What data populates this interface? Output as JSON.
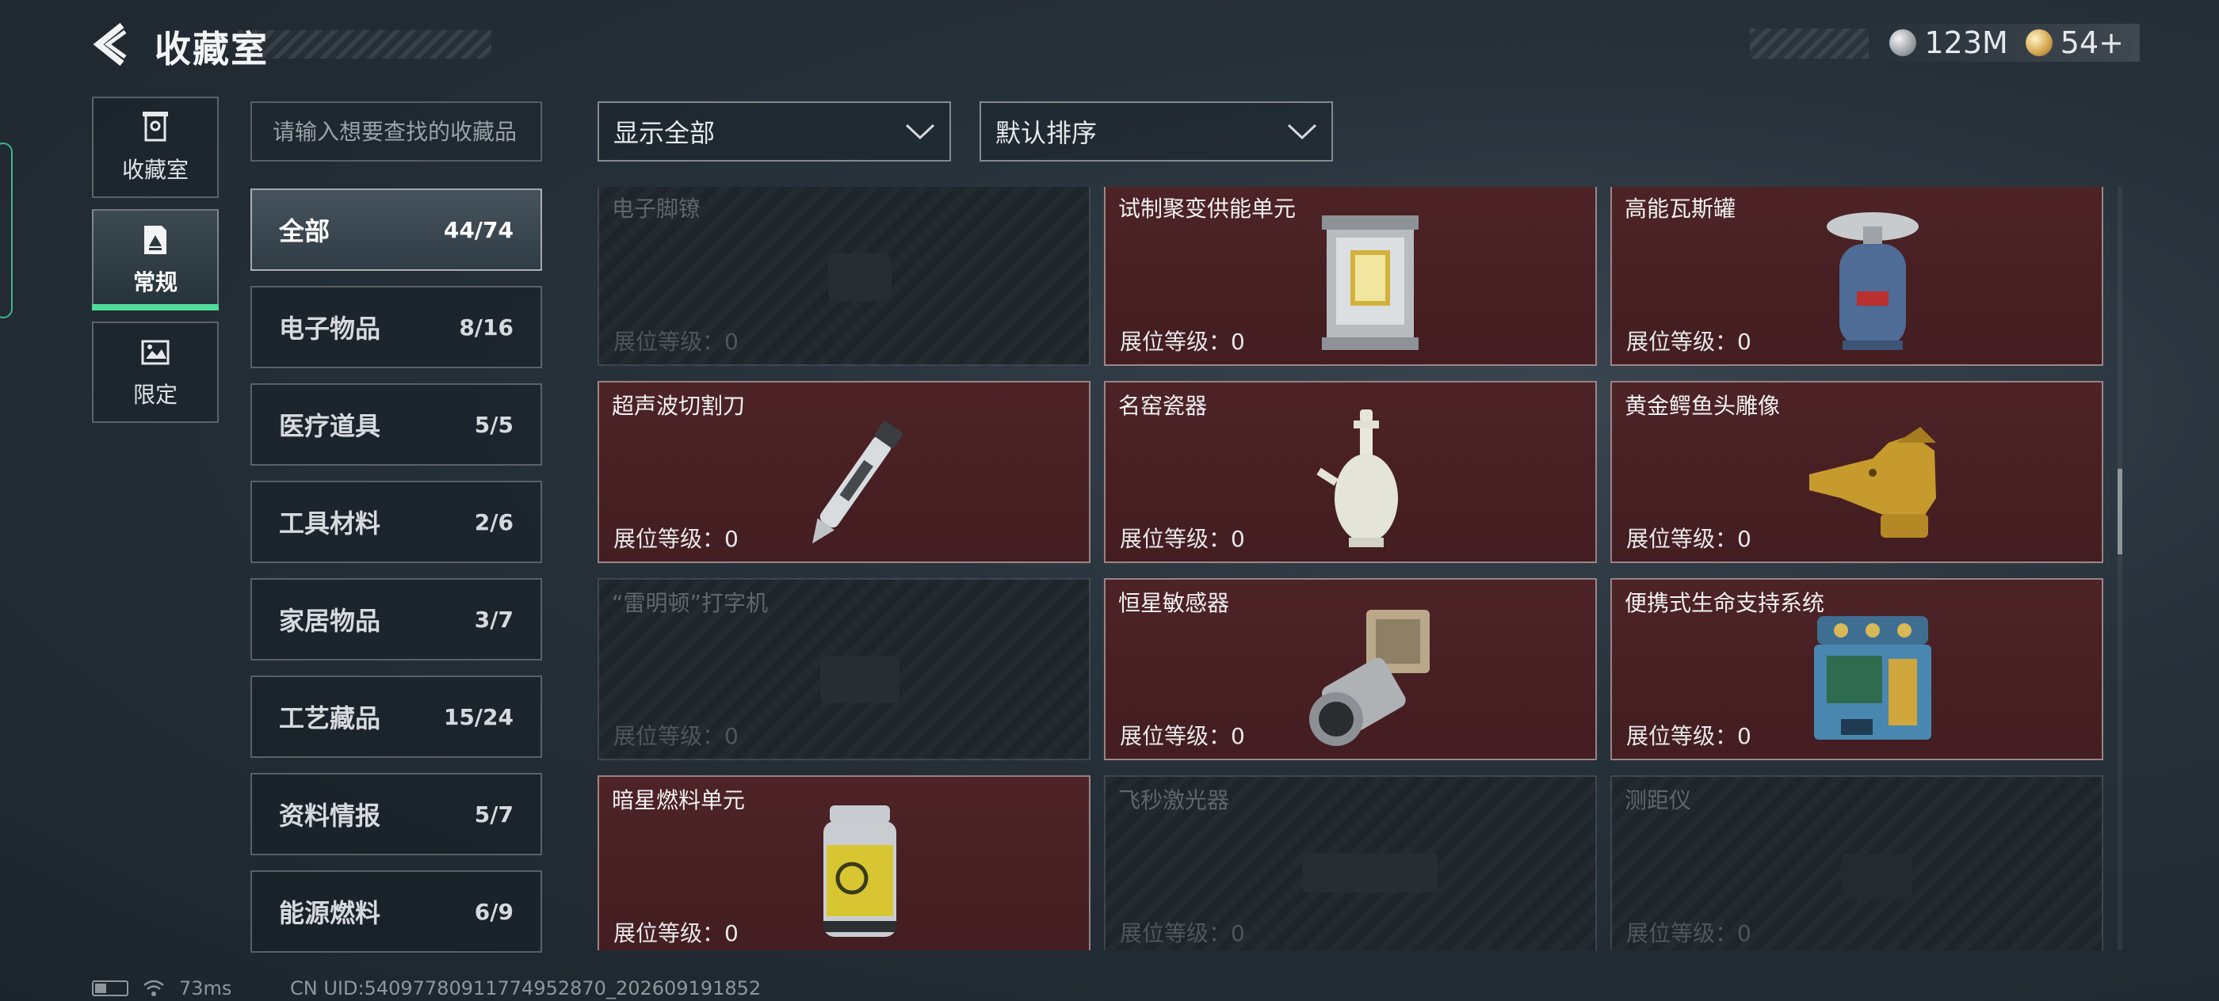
{
  "header": {
    "title": "收藏室",
    "currencies": [
      {
        "icon": "silver-coin-icon",
        "value": "123M"
      },
      {
        "icon": "gold-coin-icon",
        "value": "54+"
      }
    ]
  },
  "side_tabs": [
    {
      "label": "收藏室",
      "icon": "storage-icon",
      "active": false
    },
    {
      "label": "常规",
      "icon": "regular-collection-icon",
      "active": true
    },
    {
      "label": "限定",
      "icon": "limited-collection-icon",
      "active": false
    }
  ],
  "search": {
    "placeholder": "请输入想要查找的收藏品",
    "value": ""
  },
  "filters": {
    "display": "显示全部",
    "sort": "默认排序"
  },
  "categories": [
    {
      "name": "全部",
      "count": "44/74",
      "active": true
    },
    {
      "name": "电子物品",
      "count": "8/16"
    },
    {
      "name": "医疗道具",
      "count": "5/5"
    },
    {
      "name": "工具材料",
      "count": "2/6"
    },
    {
      "name": "家居物品",
      "count": "3/7"
    },
    {
      "name": "工艺藏品",
      "count": "15/24"
    },
    {
      "name": "资料情报",
      "count": "5/7"
    },
    {
      "name": "能源燃料",
      "count": "6/9"
    }
  ],
  "grade_label": "展位等级：",
  "items": [
    {
      "name": "电子脚镣",
      "grade": "0",
      "owned": false,
      "icon": "electronic-anklet-icon"
    },
    {
      "name": "试制聚变供能单元",
      "grade": "0",
      "owned": true,
      "icon": "fusion-power-unit-icon"
    },
    {
      "name": "高能瓦斯罐",
      "grade": "0",
      "owned": true,
      "icon": "gas-canister-icon"
    },
    {
      "name": "超声波切割刀",
      "grade": "0",
      "owned": true,
      "icon": "ultrasonic-cutter-icon"
    },
    {
      "name": "名窑瓷器",
      "grade": "0",
      "owned": true,
      "icon": "porcelain-vase-icon"
    },
    {
      "name": "黄金鳄鱼头雕像",
      "grade": "0",
      "owned": true,
      "icon": "golden-crocodile-statue-icon"
    },
    {
      "name": "“雷明顿”打字机",
      "grade": "0",
      "owned": false,
      "icon": "typewriter-icon"
    },
    {
      "name": "恒星敏感器",
      "grade": "0",
      "owned": true,
      "icon": "star-sensor-icon"
    },
    {
      "name": "便携式生命支持系统",
      "grade": "0",
      "owned": true,
      "icon": "life-support-system-icon"
    },
    {
      "name": "暗星燃料单元",
      "grade": "0",
      "owned": true,
      "icon": "fuel-cell-icon"
    },
    {
      "name": "飞秒激光器",
      "grade": "0",
      "owned": false,
      "icon": "femtosecond-laser-icon"
    },
    {
      "name": "测距仪",
      "grade": "0",
      "owned": false,
      "icon": "rangefinder-icon"
    }
  ],
  "status": {
    "ping": "73ms",
    "uid": "CN UID:54097780911774952870_202609191852"
  },
  "colors": {
    "accent": "#4fdc9a",
    "owned_card": "#4a2125",
    "locked_card": "#1e252b"
  }
}
